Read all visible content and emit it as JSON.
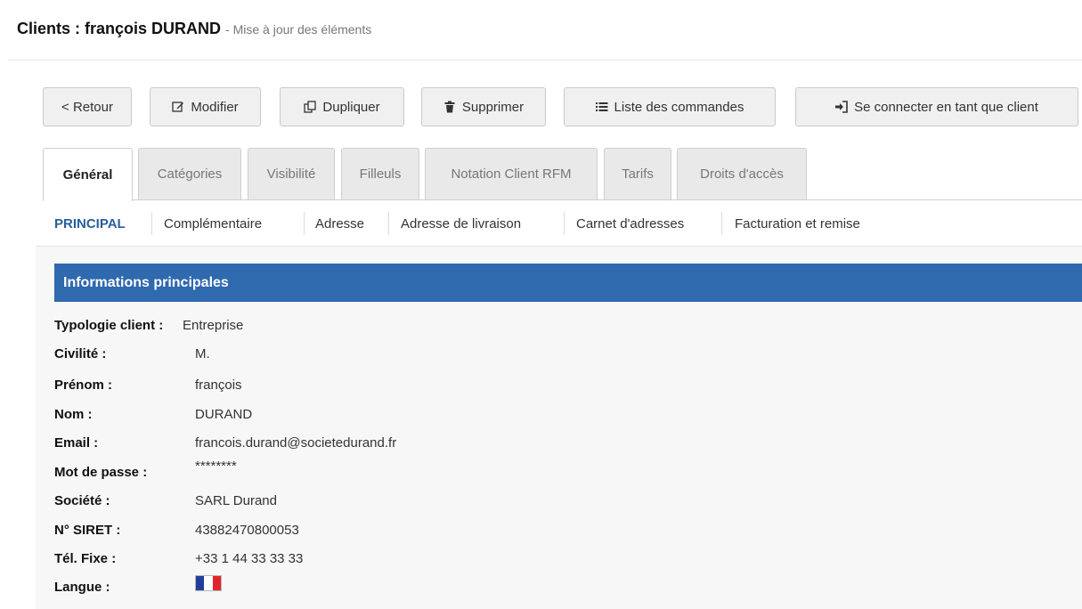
{
  "header": {
    "title": "Clients : françois DURAND",
    "subtitle": "- Mise à jour des éléments"
  },
  "toolbar": {
    "back_label": "< Retour",
    "edit_label": "Modifier",
    "duplicate_label": "Dupliquer",
    "delete_label": "Supprimer",
    "orders_label": "Liste des commandes",
    "login_as_label": "Se connecter en tant que client"
  },
  "tabs": [
    {
      "label": "Général"
    },
    {
      "label": "Catégories"
    },
    {
      "label": "Visibilité"
    },
    {
      "label": "Filleuls"
    },
    {
      "label": "Notation Client RFM"
    },
    {
      "label": "Tarifs"
    },
    {
      "label": "Droits d'accès"
    }
  ],
  "subnav": [
    {
      "label": "PRINCIPAL"
    },
    {
      "label": "Complémentaire"
    },
    {
      "label": "Adresse"
    },
    {
      "label": "Adresse de livraison"
    },
    {
      "label": "Carnet d'adresses"
    },
    {
      "label": "Facturation et remise"
    }
  ],
  "section": {
    "title": "Informations principales",
    "header_color": "#2f69ae"
  },
  "fields": [
    {
      "label": "Typologie client :",
      "value": "Entreprise"
    },
    {
      "label": "Civilité :",
      "value": "M."
    },
    {
      "label": "Prénom :",
      "value": "françois"
    },
    {
      "label": "Nom :",
      "value": "DURAND"
    },
    {
      "label": "Email :",
      "value": "francois.durand@societedurand.fr"
    },
    {
      "label": "Mot de passe :",
      "value": "********"
    },
    {
      "label": "Société :",
      "value": "SARL Durand"
    },
    {
      "label": "N° SIRET :",
      "value": "43882470800053"
    },
    {
      "label": "Tél. Fixe :",
      "value": "+33 1 44 33 33 33"
    },
    {
      "label": "Langue :",
      "value_icon": "france-flag-icon"
    }
  ]
}
